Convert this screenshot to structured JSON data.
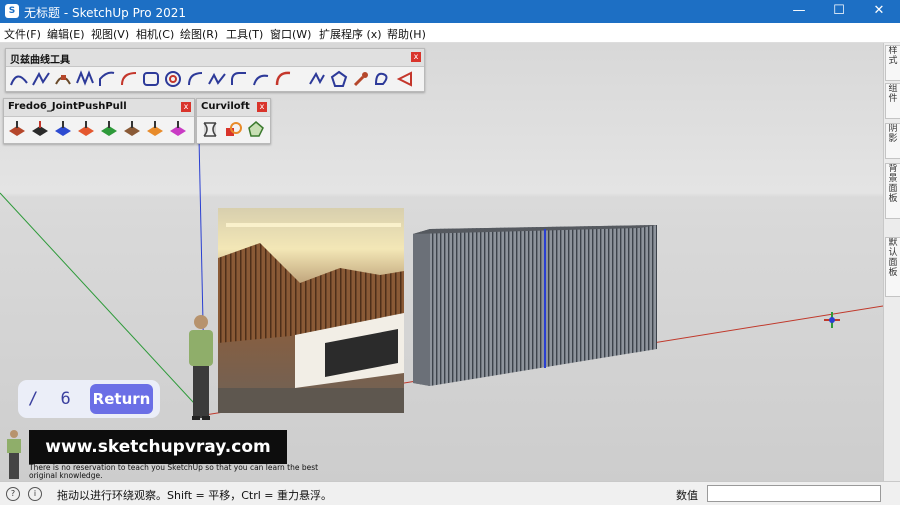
{
  "window": {
    "title": "无标题 - SketchUp Pro 2021",
    "minimize": "—",
    "maximize": "☐",
    "close": "✕"
  },
  "menu": [
    {
      "label": "文件(F)"
    },
    {
      "label": "编辑(E)"
    },
    {
      "label": "视图(V)"
    },
    {
      "label": "相机(C)"
    },
    {
      "label": "绘图(R)"
    },
    {
      "label": "工具(T)"
    },
    {
      "label": "窗口(W)"
    },
    {
      "label": "扩展程序 (x)"
    },
    {
      "label": "帮助(H)"
    }
  ],
  "toolbars": {
    "bezier": {
      "title": "贝兹曲线工具",
      "close": "x"
    },
    "fredo": {
      "title": "Fredo6_JointPushPull",
      "close": "x"
    },
    "curviloft": {
      "title": "Curviloft",
      "close": "x"
    }
  },
  "trays": [
    {
      "label": "样式"
    },
    {
      "label": "组件"
    },
    {
      "label": "阴影"
    },
    {
      "label": "背景面板"
    },
    {
      "label": "默认面板"
    }
  ],
  "overlay": {
    "counter": "/ 6 0",
    "return_label": "Return",
    "banner": "www.sketchupvray.com",
    "banner_note": "There is no reservation to teach you SketchUp so that you can learn the best original knowledge."
  },
  "status": {
    "hint": "拖动以进行环绕观察。Shift = 平移，Ctrl = 重力悬浮。",
    "measure_label": "数值",
    "measure_value": ""
  },
  "colors": {
    "titlebar": "#1d6fc4",
    "return_button": "#6b6fe6",
    "red_axis": "#c0392b",
    "green_axis": "#2e9a3a",
    "blue_axis": "#2a3fd1",
    "wall_panel": "#8f949c"
  }
}
